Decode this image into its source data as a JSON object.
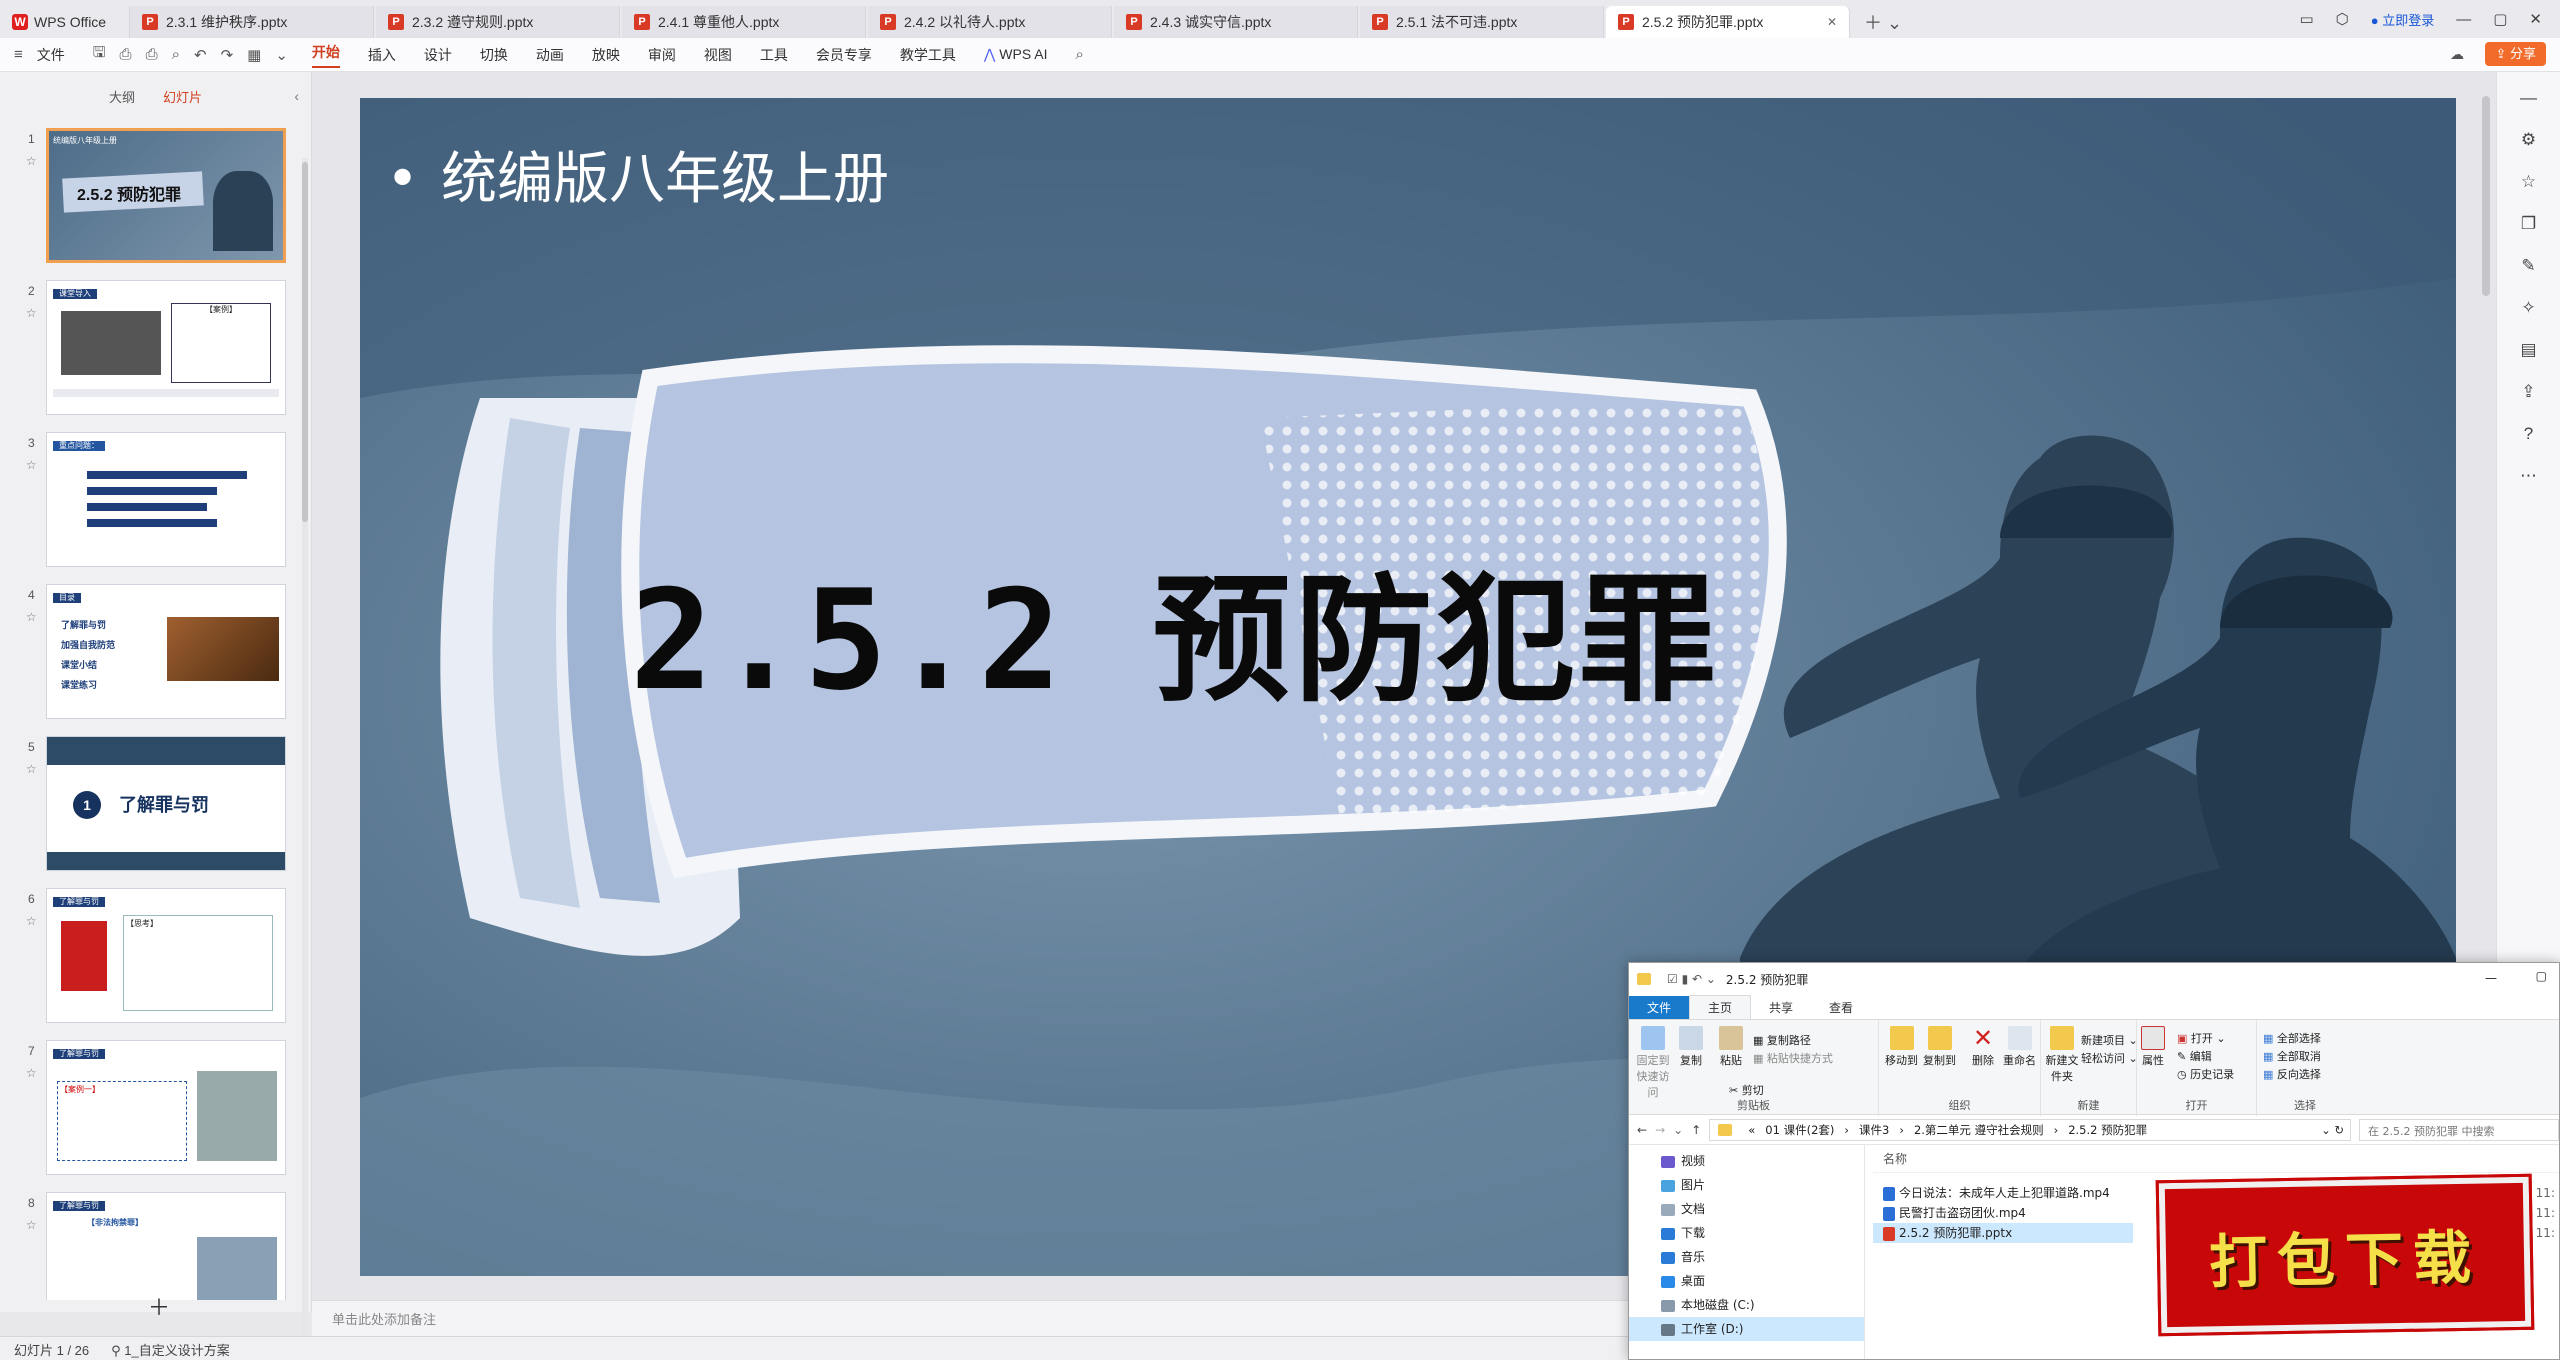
{
  "app": {
    "home_tab": "WPS Office"
  },
  "tabs": [
    {
      "label": "2.3.1 维护秩序.pptx"
    },
    {
      "label": "2.3.2 遵守规则.pptx"
    },
    {
      "label": "2.4.1 尊重他人.pptx"
    },
    {
      "label": "2.4.2 以礼待人.pptx"
    },
    {
      "label": "2.4.3 诚实守信.pptx"
    },
    {
      "label": "2.5.1 法不可违.pptx"
    },
    {
      "label": "2.5.2 预防犯罪.pptx"
    }
  ],
  "window": {
    "login": "立即登录",
    "share": "分享"
  },
  "ribbon": {
    "file": "文件",
    "items": [
      "开始",
      "插入",
      "设计",
      "切换",
      "动画",
      "放映",
      "审阅",
      "视图",
      "工具",
      "会员专享",
      "教学工具"
    ],
    "ai": "WPS AI"
  },
  "left_panel": {
    "tab_outline": "大纲",
    "tab_slides": "幻灯片",
    "thumbs": [
      {
        "num": "1",
        "title": "2.5.2 预防犯罪",
        "tag": "统编版八年级上册"
      },
      {
        "num": "2",
        "title": "课堂导入",
        "tag": "【案例】"
      },
      {
        "num": "3",
        "title": "重点问题：",
        "tag": ""
      },
      {
        "num": "4",
        "title": "目录",
        "items": [
          "了解罪与罚",
          "加强自我防范",
          "课堂小结",
          "课堂练习"
        ]
      },
      {
        "num": "5",
        "title": "了解罪与罚",
        "badge": "1"
      },
      {
        "num": "6",
        "title": "了解罪与罚",
        "tag": "【思考】"
      },
      {
        "num": "7",
        "title": "了解罪与罚",
        "tag": "【案例一】"
      },
      {
        "num": "8",
        "title": "了解罪与罚",
        "tag": "【非法拘禁罪】"
      }
    ]
  },
  "slide": {
    "bullet": "统编版八年级上册",
    "title": "2.5.2 预防犯罪"
  },
  "notes_placeholder": "单击此处添加备注",
  "status": {
    "slide_counter": "幻灯片 1 / 26",
    "theme": "1_自定义设计方案"
  },
  "explorer": {
    "title": "2.5.2 预防犯罪",
    "tabs": [
      "文件",
      "主页",
      "共享",
      "查看"
    ],
    "ribbon": {
      "pin": "固定到快速访问",
      "copy": "复制",
      "paste": "粘贴",
      "copy_path": "复制路径",
      "paste_shortcut": "粘贴快捷方式",
      "cut": "剪切",
      "clipboard_group": "剪贴板",
      "move_to": "移动到",
      "copy_to": "复制到",
      "delete": "删除",
      "rename": "重命名",
      "organize_group": "组织",
      "new_folder": "新建文件夹",
      "new_item": "新建项目",
      "easy_access": "轻松访问",
      "new_group": "新建",
      "properties": "属性",
      "open": "打开",
      "edit": "编辑",
      "history": "历史记录",
      "open_group": "打开",
      "select_all": "全部选择",
      "select_none": "全部取消",
      "invert": "反向选择",
      "select_group": "选择"
    },
    "path": [
      "01 课件(2套)",
      "课件3",
      "2.第二单元 遵守社会规则",
      "2.5.2 预防犯罪"
    ],
    "search_placeholder": "在 2.5.2 预防犯罪 中搜索",
    "nav": [
      "视频",
      "图片",
      "文档",
      "下载",
      "音乐",
      "桌面",
      "本地磁盘 (C:)",
      "工作室 (D:)"
    ],
    "col_name": "名称",
    "files": [
      {
        "name": "今日说法：未成年人走上犯罪道路.mp4",
        "date": "2/2 11:"
      },
      {
        "name": "民警打击盗窃团伙.mp4",
        "date": "2/2 11:"
      },
      {
        "name": "2.5.2 预防犯罪.pptx",
        "date": "2/2 11:"
      }
    ]
  },
  "download_button": "打包下载",
  "colors": {
    "accent": "#d04020",
    "slide_bg": "#55738e",
    "download_red": "#c80808"
  }
}
